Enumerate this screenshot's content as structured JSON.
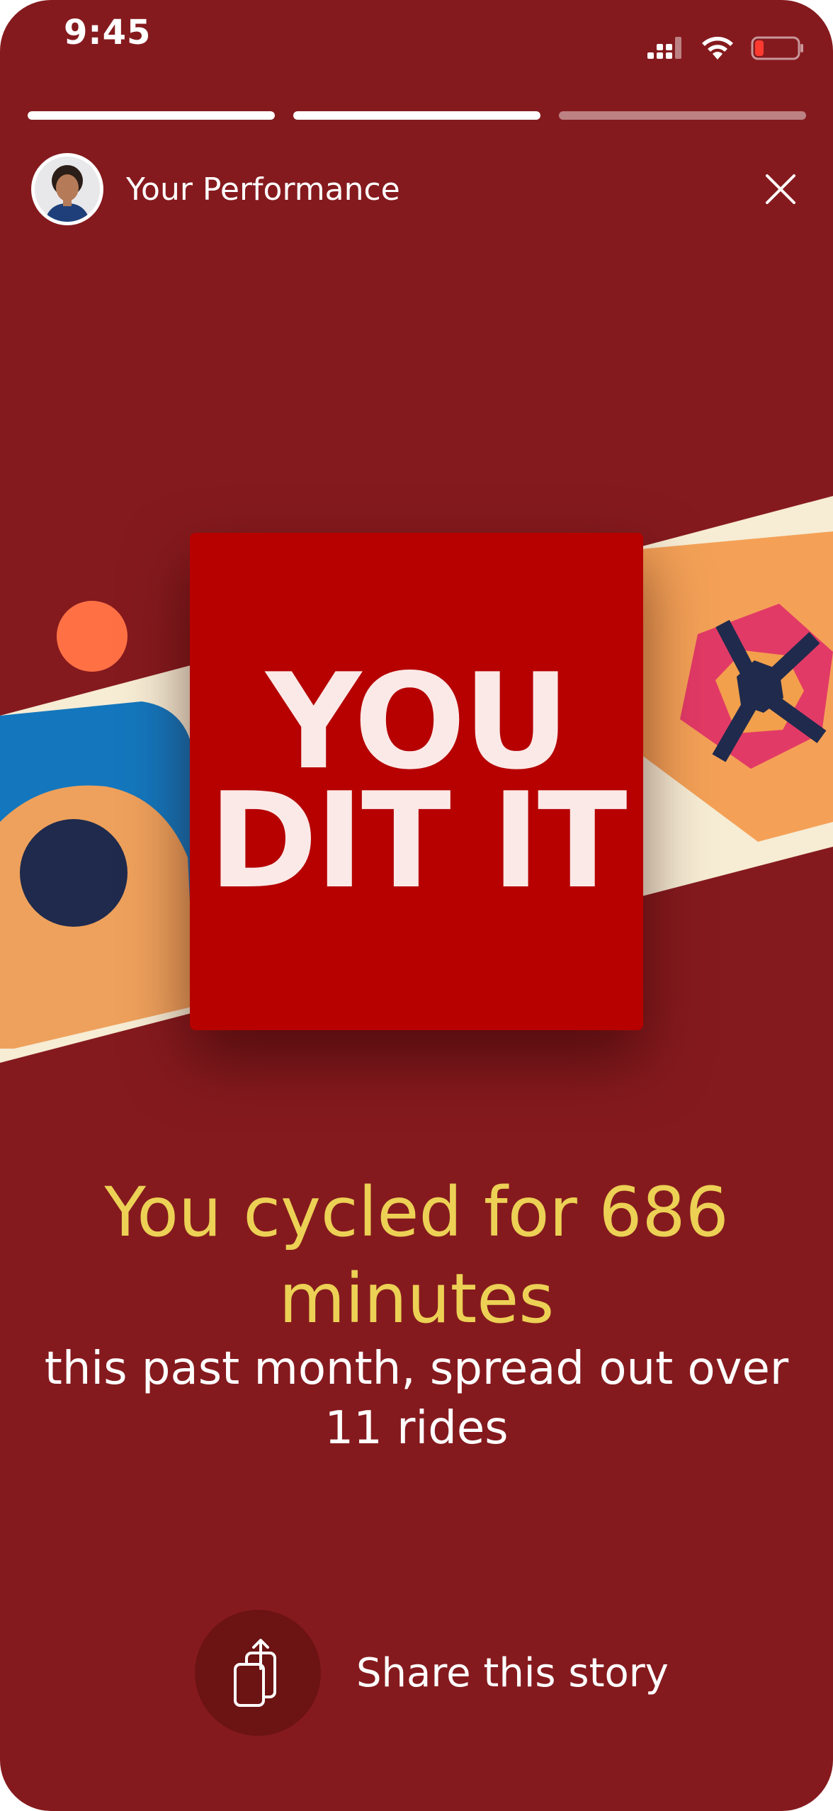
{
  "status_bar": {
    "time": "9:45",
    "icons": [
      "signal-icon",
      "wifi-icon",
      "battery-low-icon"
    ]
  },
  "progress": {
    "segments": [
      1,
      1,
      0
    ]
  },
  "header": {
    "title": "Your Performance",
    "avatar_icon": "avatar",
    "close_icon": "close-icon"
  },
  "artwork": {
    "line1": "YOU",
    "line2": "DIT IT"
  },
  "summary": {
    "headline": "You cycled for 686 minutes",
    "subline": "this past month, spread out over 11 rides"
  },
  "share": {
    "label": "Share this story",
    "icon": "share-icon"
  },
  "colors": {
    "background": "#851a1e",
    "card": "#b70000",
    "headline": "#ecd155",
    "share_circle": "#6c1314"
  }
}
